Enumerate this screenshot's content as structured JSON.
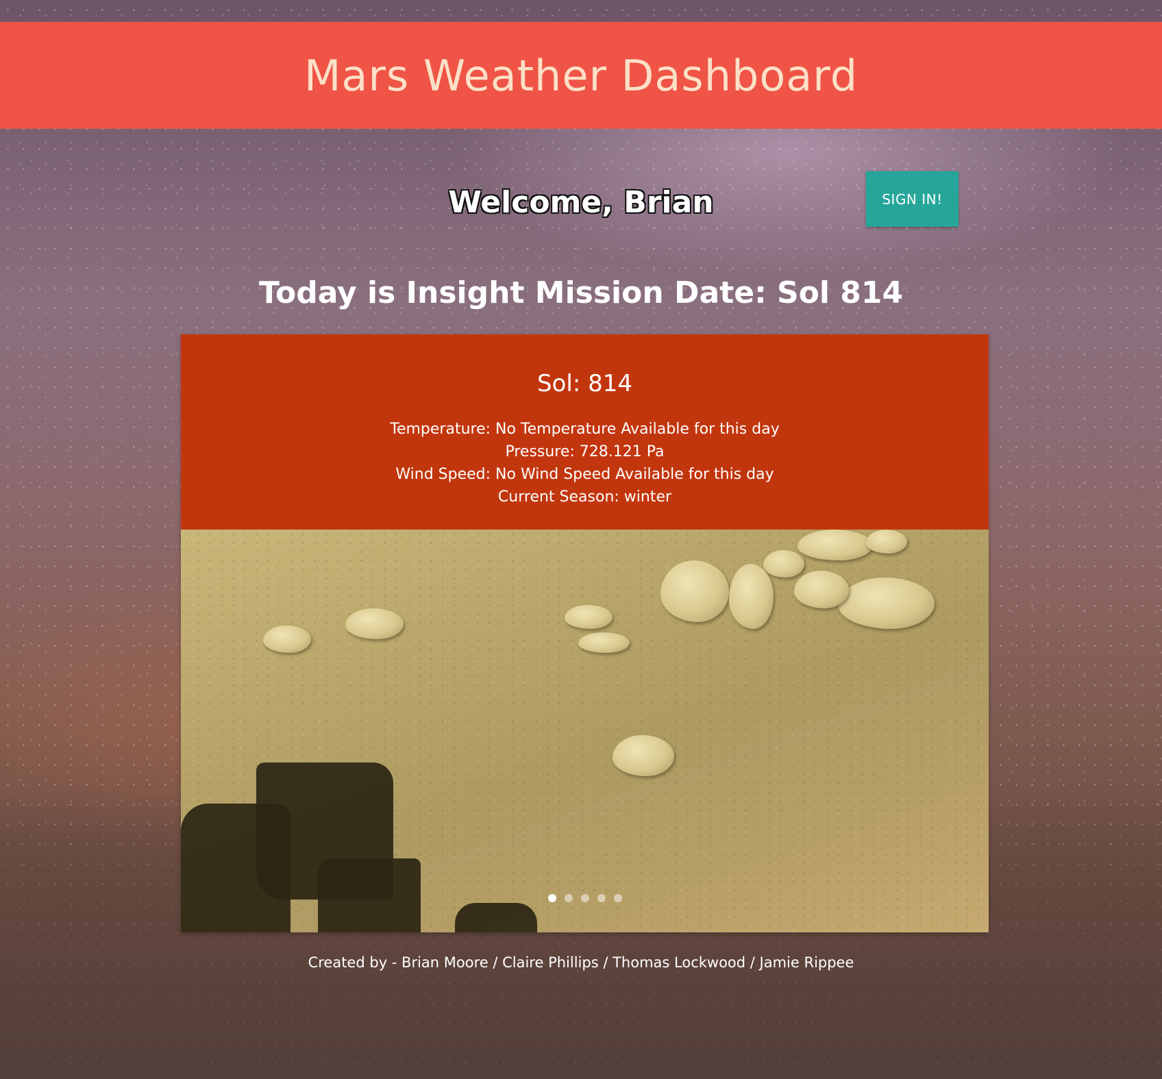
{
  "header": {
    "title": "Mars Weather Dashboard"
  },
  "welcome": {
    "text": "Welcome, Brian",
    "signin_label": "SIGN IN!"
  },
  "mission": {
    "text": "Today is Insight Mission Date: Sol 814"
  },
  "weather": {
    "sol_label": "Sol: 814",
    "temperature": "Temperature: No Temperature Available for this day",
    "pressure": "Pressure: 728.121 Pa",
    "wind_speed": "Wind Speed: No Wind Speed Available for this day",
    "season": "Current Season: winter"
  },
  "carousel": {
    "slide_count": 5,
    "active_index": 0
  },
  "footer": {
    "credits": "Created by - Brian Moore / Claire Phillips / Thomas Lockwood / Jamie Rippee"
  },
  "colors": {
    "header_bg": "#ef5446",
    "header_text": "#fbe0c7",
    "card_bg": "#c2360e",
    "signin_bg": "#26a69a"
  }
}
